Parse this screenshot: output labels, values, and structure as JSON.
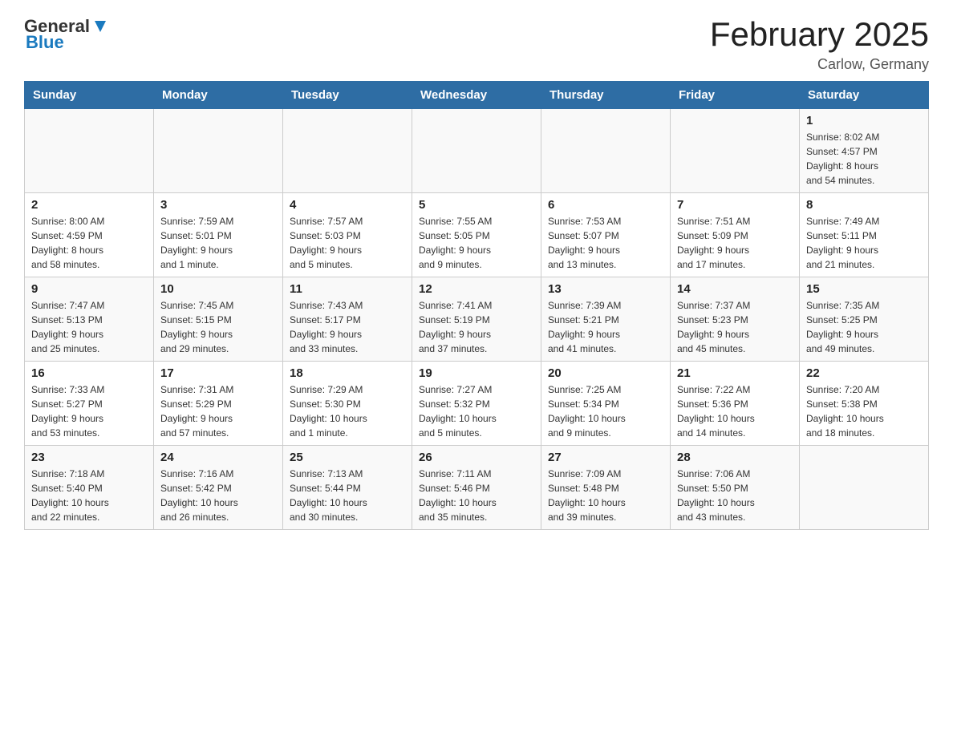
{
  "header": {
    "logo": {
      "text_general": "General",
      "text_blue": "Blue"
    },
    "title": "February 2025",
    "location": "Carlow, Germany"
  },
  "weekdays": [
    "Sunday",
    "Monday",
    "Tuesday",
    "Wednesday",
    "Thursday",
    "Friday",
    "Saturday"
  ],
  "weeks": [
    {
      "days": [
        {
          "number": "",
          "info": ""
        },
        {
          "number": "",
          "info": ""
        },
        {
          "number": "",
          "info": ""
        },
        {
          "number": "",
          "info": ""
        },
        {
          "number": "",
          "info": ""
        },
        {
          "number": "",
          "info": ""
        },
        {
          "number": "1",
          "info": "Sunrise: 8:02 AM\nSunset: 4:57 PM\nDaylight: 8 hours\nand 54 minutes."
        }
      ]
    },
    {
      "days": [
        {
          "number": "2",
          "info": "Sunrise: 8:00 AM\nSunset: 4:59 PM\nDaylight: 8 hours\nand 58 minutes."
        },
        {
          "number": "3",
          "info": "Sunrise: 7:59 AM\nSunset: 5:01 PM\nDaylight: 9 hours\nand 1 minute."
        },
        {
          "number": "4",
          "info": "Sunrise: 7:57 AM\nSunset: 5:03 PM\nDaylight: 9 hours\nand 5 minutes."
        },
        {
          "number": "5",
          "info": "Sunrise: 7:55 AM\nSunset: 5:05 PM\nDaylight: 9 hours\nand 9 minutes."
        },
        {
          "number": "6",
          "info": "Sunrise: 7:53 AM\nSunset: 5:07 PM\nDaylight: 9 hours\nand 13 minutes."
        },
        {
          "number": "7",
          "info": "Sunrise: 7:51 AM\nSunset: 5:09 PM\nDaylight: 9 hours\nand 17 minutes."
        },
        {
          "number": "8",
          "info": "Sunrise: 7:49 AM\nSunset: 5:11 PM\nDaylight: 9 hours\nand 21 minutes."
        }
      ]
    },
    {
      "days": [
        {
          "number": "9",
          "info": "Sunrise: 7:47 AM\nSunset: 5:13 PM\nDaylight: 9 hours\nand 25 minutes."
        },
        {
          "number": "10",
          "info": "Sunrise: 7:45 AM\nSunset: 5:15 PM\nDaylight: 9 hours\nand 29 minutes."
        },
        {
          "number": "11",
          "info": "Sunrise: 7:43 AM\nSunset: 5:17 PM\nDaylight: 9 hours\nand 33 minutes."
        },
        {
          "number": "12",
          "info": "Sunrise: 7:41 AM\nSunset: 5:19 PM\nDaylight: 9 hours\nand 37 minutes."
        },
        {
          "number": "13",
          "info": "Sunrise: 7:39 AM\nSunset: 5:21 PM\nDaylight: 9 hours\nand 41 minutes."
        },
        {
          "number": "14",
          "info": "Sunrise: 7:37 AM\nSunset: 5:23 PM\nDaylight: 9 hours\nand 45 minutes."
        },
        {
          "number": "15",
          "info": "Sunrise: 7:35 AM\nSunset: 5:25 PM\nDaylight: 9 hours\nand 49 minutes."
        }
      ]
    },
    {
      "days": [
        {
          "number": "16",
          "info": "Sunrise: 7:33 AM\nSunset: 5:27 PM\nDaylight: 9 hours\nand 53 minutes."
        },
        {
          "number": "17",
          "info": "Sunrise: 7:31 AM\nSunset: 5:29 PM\nDaylight: 9 hours\nand 57 minutes."
        },
        {
          "number": "18",
          "info": "Sunrise: 7:29 AM\nSunset: 5:30 PM\nDaylight: 10 hours\nand 1 minute."
        },
        {
          "number": "19",
          "info": "Sunrise: 7:27 AM\nSunset: 5:32 PM\nDaylight: 10 hours\nand 5 minutes."
        },
        {
          "number": "20",
          "info": "Sunrise: 7:25 AM\nSunset: 5:34 PM\nDaylight: 10 hours\nand 9 minutes."
        },
        {
          "number": "21",
          "info": "Sunrise: 7:22 AM\nSunset: 5:36 PM\nDaylight: 10 hours\nand 14 minutes."
        },
        {
          "number": "22",
          "info": "Sunrise: 7:20 AM\nSunset: 5:38 PM\nDaylight: 10 hours\nand 18 minutes."
        }
      ]
    },
    {
      "days": [
        {
          "number": "23",
          "info": "Sunrise: 7:18 AM\nSunset: 5:40 PM\nDaylight: 10 hours\nand 22 minutes."
        },
        {
          "number": "24",
          "info": "Sunrise: 7:16 AM\nSunset: 5:42 PM\nDaylight: 10 hours\nand 26 minutes."
        },
        {
          "number": "25",
          "info": "Sunrise: 7:13 AM\nSunset: 5:44 PM\nDaylight: 10 hours\nand 30 minutes."
        },
        {
          "number": "26",
          "info": "Sunrise: 7:11 AM\nSunset: 5:46 PM\nDaylight: 10 hours\nand 35 minutes."
        },
        {
          "number": "27",
          "info": "Sunrise: 7:09 AM\nSunset: 5:48 PM\nDaylight: 10 hours\nand 39 minutes."
        },
        {
          "number": "28",
          "info": "Sunrise: 7:06 AM\nSunset: 5:50 PM\nDaylight: 10 hours\nand 43 minutes."
        },
        {
          "number": "",
          "info": ""
        }
      ]
    }
  ]
}
